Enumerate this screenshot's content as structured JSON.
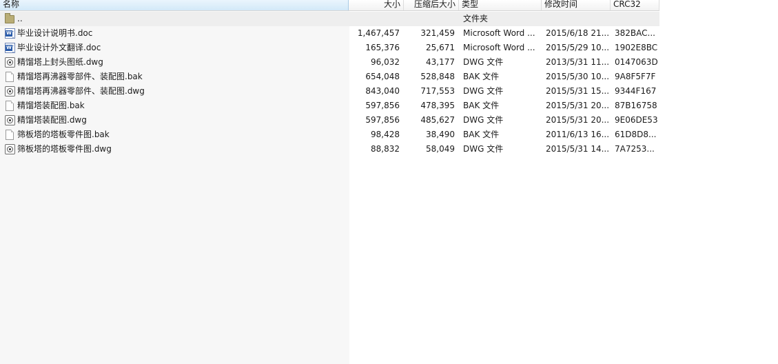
{
  "columns": {
    "name": "名称",
    "size": "大小",
    "packed": "压缩后大小",
    "type": "类型",
    "modified": "修改时间",
    "crc": "CRC32"
  },
  "parent": {
    "name": "..",
    "type": "文件夹",
    "icon": "folder-icon"
  },
  "files": [
    {
      "name": "毕业设计说明书.doc",
      "size": "1,467,457",
      "packed": "321,459",
      "type": "Microsoft Word ...",
      "modified": "2015/6/18 21...",
      "crc": "382BAC...",
      "icon": "word-doc-icon"
    },
    {
      "name": "毕业设计外文翻译.doc",
      "size": "165,376",
      "packed": "25,671",
      "type": "Microsoft Word ...",
      "modified": "2015/5/29 10...",
      "crc": "1902E8BC",
      "icon": "word-doc-icon"
    },
    {
      "name": "精馏塔上封头图纸.dwg",
      "size": "96,032",
      "packed": "43,177",
      "type": "DWG 文件",
      "modified": "2013/5/31 11...",
      "crc": "0147063D",
      "icon": "dwg-file-icon"
    },
    {
      "name": "精馏塔再沸器零部件、装配图.bak",
      "size": "654,048",
      "packed": "528,848",
      "type": "BAK 文件",
      "modified": "2015/5/30 10...",
      "crc": "9A8F5F7F",
      "icon": "bak-file-icon"
    },
    {
      "name": "精馏塔再沸器零部件、装配图.dwg",
      "size": "843,040",
      "packed": "717,553",
      "type": "DWG 文件",
      "modified": "2015/5/31 15...",
      "crc": "9344F167",
      "icon": "dwg-file-icon"
    },
    {
      "name": "精馏塔装配图.bak",
      "size": "597,856",
      "packed": "478,395",
      "type": "BAK 文件",
      "modified": "2015/5/31 20...",
      "crc": "87B16758",
      "icon": "bak-file-icon"
    },
    {
      "name": "精馏塔装配图.dwg",
      "size": "597,856",
      "packed": "485,627",
      "type": "DWG 文件",
      "modified": "2015/5/31 20...",
      "crc": "9E06DE53",
      "icon": "dwg-file-icon"
    },
    {
      "name": "筛板塔的塔板零件图.bak",
      "size": "98,428",
      "packed": "38,490",
      "type": "BAK 文件",
      "modified": "2011/6/13 16...",
      "crc": "61D8D8...",
      "icon": "bak-file-icon"
    },
    {
      "name": "筛板塔的塔板零件图.dwg",
      "size": "88,832",
      "packed": "58,049",
      "type": "DWG 文件",
      "modified": "2015/5/31 14...",
      "crc": "7A7253...",
      "icon": "dwg-file-icon"
    }
  ]
}
